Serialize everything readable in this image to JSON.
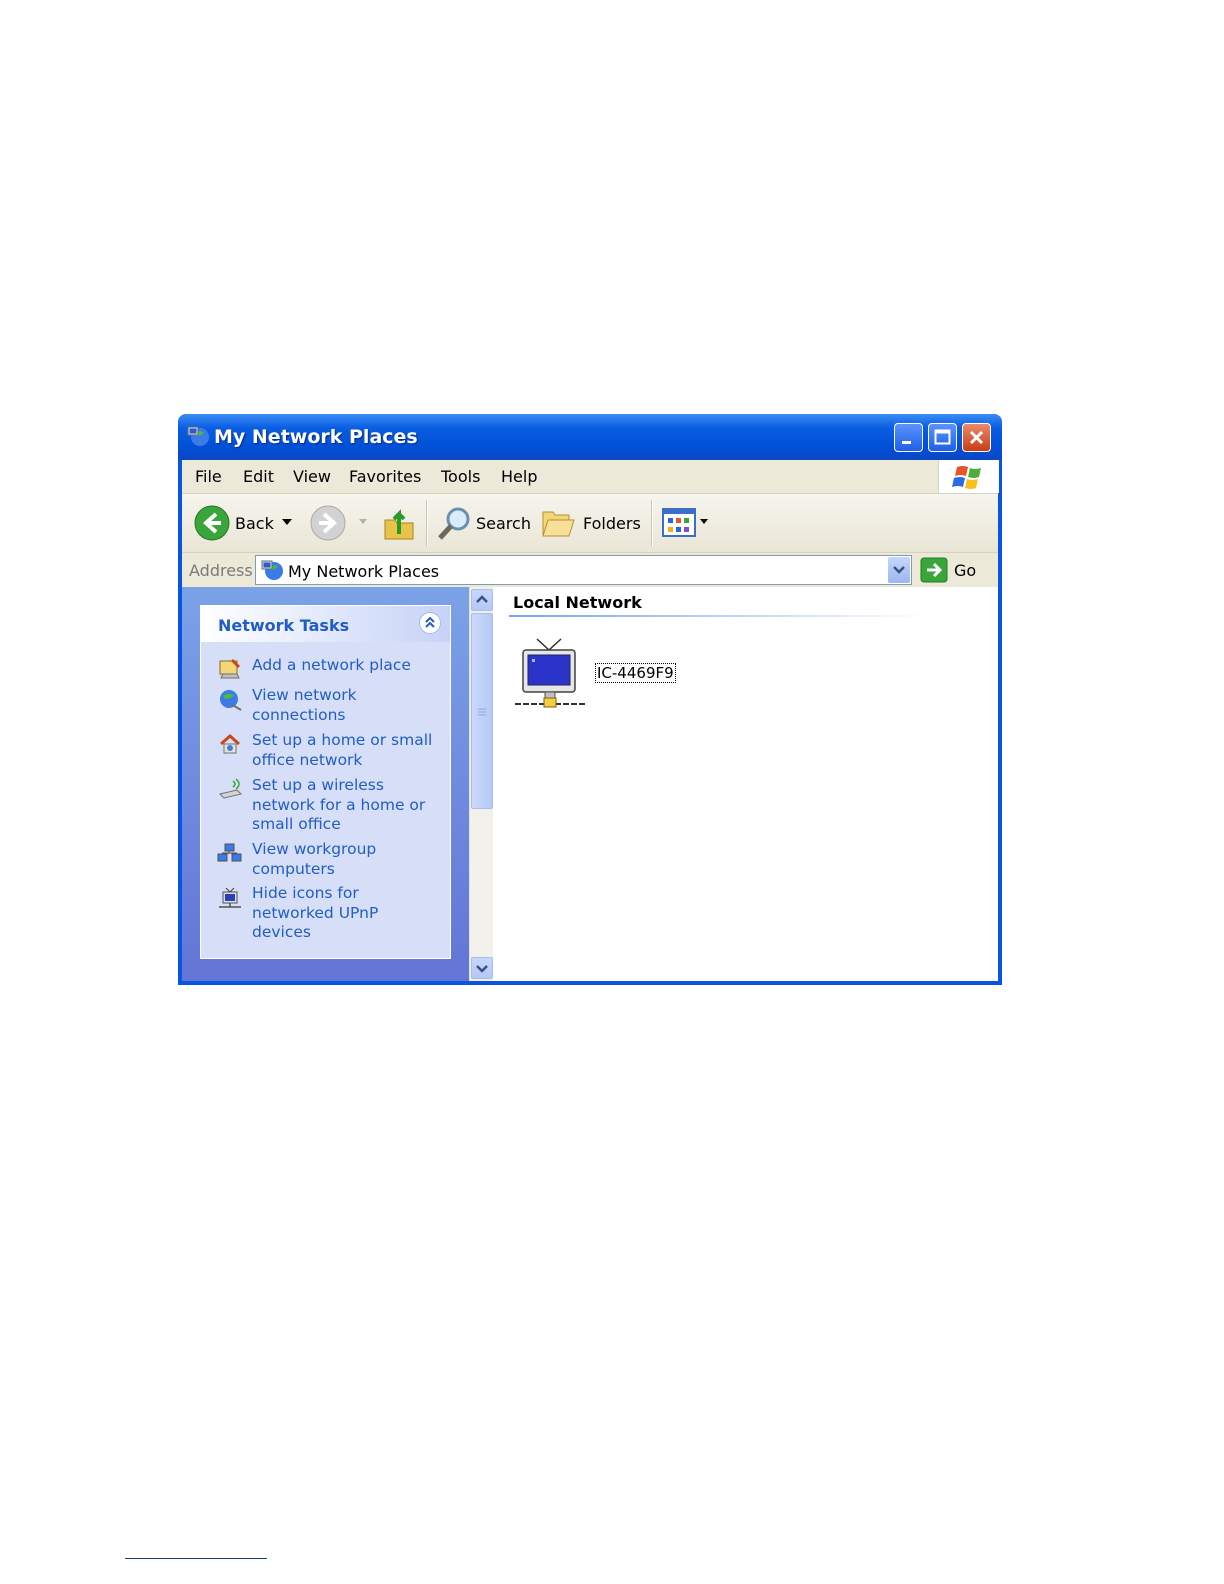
{
  "window": {
    "title": "My Network Places"
  },
  "menu": [
    "File",
    "Edit",
    "View",
    "Favorites",
    "Tools",
    "Help"
  ],
  "toolbar": {
    "back": "Back",
    "search": "Search",
    "folders": "Folders"
  },
  "address": {
    "label": "Address",
    "value": "My Network Places",
    "go": "Go"
  },
  "tasks": {
    "title": "Network Tasks",
    "items": [
      {
        "label": "Add a network place",
        "icon": "add-network-place-icon"
      },
      {
        "label": "View network connections",
        "icon": "network-connections-icon"
      },
      {
        "label": "Set up a home or small office network",
        "icon": "home-network-icon"
      },
      {
        "label": "Set up a wireless network for a home or small office",
        "icon": "wireless-network-icon"
      },
      {
        "label": "View workgroup computers",
        "icon": "workgroup-icon"
      },
      {
        "label": "Hide icons for networked UPnP devices",
        "icon": "upnp-device-icon"
      }
    ]
  },
  "content": {
    "group": "Local Network",
    "device": {
      "label": "IC-4469F9",
      "icon": "upnp-monitor-icon"
    }
  },
  "colors": {
    "title_bar": "#0a5ee0",
    "task_link": "#215dc6",
    "chrome": "#ece9d8"
  }
}
